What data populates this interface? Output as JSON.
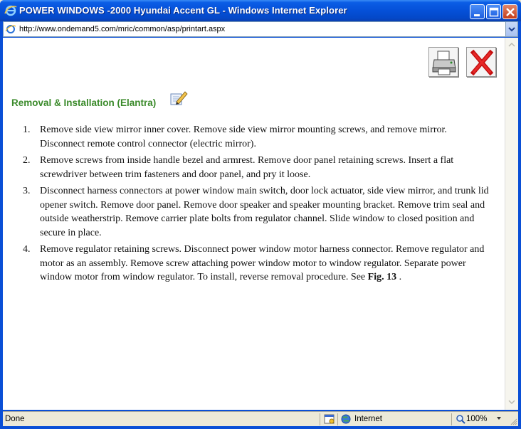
{
  "window": {
    "title": "POWER WINDOWS -2000 Hyundai Accent GL - Windows Internet Explorer",
    "address": "http://www.ondemand5.com/mric/common/asp/printart.aspx"
  },
  "toolbar": {
    "print_icon": "printer-icon",
    "close_icon": "red-x-close-icon"
  },
  "article": {
    "heading": "Removal & Installation (Elantra)",
    "heading_icon": "notepad-pencil-icon",
    "steps": [
      {
        "num": "1.",
        "text": "Remove side view mirror inner cover. Remove side view mirror mounting screws, and remove mirror. Disconnect remote control connector (electric mirror)."
      },
      {
        "num": "2.",
        "text": "Remove screws from inside handle bezel and armrest. Remove door panel retaining screws. Insert a flat screwdriver between trim fasteners and door panel, and pry it loose."
      },
      {
        "num": "3.",
        "text": "Disconnect harness connectors at power window main switch, door lock actuator, side view mirror, and trunk lid opener switch. Remove door panel. Remove door speaker and speaker mounting bracket. Remove trim seal and outside weatherstrip. Remove carrier plate bolts from regulator channel. Slide window to closed position and secure in place."
      },
      {
        "num": "4.",
        "text": "Remove regulator retaining screws. Disconnect power window motor harness connector. Remove regulator and motor as an assembly. Remove screw attaching power window motor to window regulator. Separate power window motor from window regulator. To install, reverse removal procedure. See ",
        "link": "Fig. 13",
        "tail": " ."
      }
    ]
  },
  "status": {
    "text": "Done",
    "zone": "Internet",
    "zoom": "100%"
  }
}
